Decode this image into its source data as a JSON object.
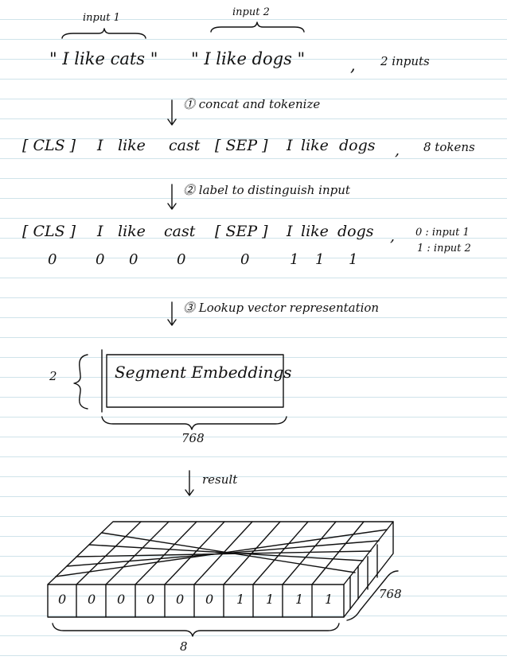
{
  "inputs": {
    "label1": "input 1",
    "label2": "input 2",
    "text1": "\" I like cats \"",
    "text2": "\" I like dogs \"",
    "comma": ",",
    "count": "2 inputs"
  },
  "steps": [
    {
      "num": "1",
      "label": "concat and tokenize"
    },
    {
      "num": "2",
      "label": "label to distinguish input"
    },
    {
      "num": "3",
      "label": "Lookup vector representation"
    },
    {
      "num": "",
      "label": "result"
    }
  ],
  "tokens": [
    "[ CLS ]",
    "I",
    "like",
    "cast",
    "[ SEP ]",
    "I",
    "like",
    "dogs"
  ],
  "token_count": "8 tokens",
  "comma": ",",
  "segment_ids": [
    "0",
    "0",
    "0",
    "0",
    "0",
    "1",
    "1",
    "1"
  ],
  "legend": [
    "0 : input 1",
    "1 : input 2"
  ],
  "embedding": {
    "title": "Segment Embeddings",
    "rows": "2",
    "width": "768"
  },
  "result": {
    "cells": [
      "0",
      "0",
      "0",
      "0",
      "0",
      "0",
      "1",
      "1",
      "1",
      "1"
    ],
    "depth": "768",
    "length": "8"
  }
}
